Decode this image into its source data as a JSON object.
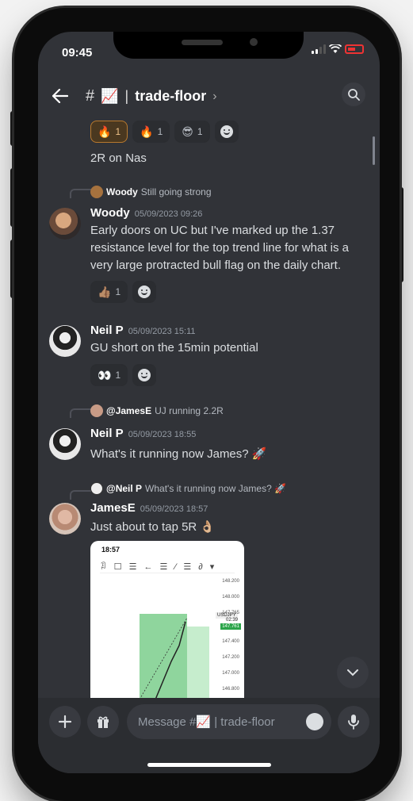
{
  "status": {
    "time": "09:45"
  },
  "header": {
    "channel_prefix": "#",
    "channel_emoji": "📈",
    "separator": "|",
    "channel_name": "trade-floor",
    "chevron": "›"
  },
  "messages": [
    {
      "reactions": [
        {
          "emoji": "🔥",
          "count": "1",
          "active": true
        },
        {
          "emoji": "🔥",
          "count": "1",
          "active": false
        },
        {
          "emoji": "😎",
          "count": "1",
          "active": false
        }
      ],
      "text": "2R on Nas"
    },
    {
      "reply_to": {
        "author": "Woody",
        "text": "Still going strong"
      },
      "author": "Woody",
      "timestamp": "05/09/2023 09:26",
      "text": "Early doors on UC but I've marked up the 1.37 resistance level for the top trend line for what is a very large protracted bull flag on the daily chart.",
      "reactions": [
        {
          "emoji": "👍🏽",
          "count": "1"
        }
      ]
    },
    {
      "author": "Neil P",
      "timestamp": "05/09/2023 15:11",
      "text": "GU short on the 15min potential",
      "reactions": [
        {
          "emoji": "👀",
          "count": "1"
        }
      ]
    },
    {
      "reply_to": {
        "author": "@JamesE",
        "text": "UJ running 2.2R"
      },
      "author": "Neil P",
      "timestamp": "05/09/2023 18:55",
      "text": "What's it running now James? 🚀"
    },
    {
      "reply_to": {
        "author": "@Neil P",
        "text": "What's it running now James? 🚀"
      },
      "author": "JamesE",
      "timestamp": "05/09/2023 18:57",
      "text": "Just about to tap 5R 👌🏼",
      "attachment": {
        "time": "18:57",
        "symbol": "USDJPY",
        "prices": [
          "148.200",
          "148.000",
          "147.765",
          "147.761",
          "147.400",
          "147.200",
          "147.000",
          "146.800"
        ],
        "current_price": "147.765",
        "countdown": "02:39"
      }
    }
  ],
  "composer": {
    "placeholder": "Message #📈 | trade-floor"
  },
  "colors": {
    "background": "#313338",
    "accent_reaction": "#b8792e"
  }
}
